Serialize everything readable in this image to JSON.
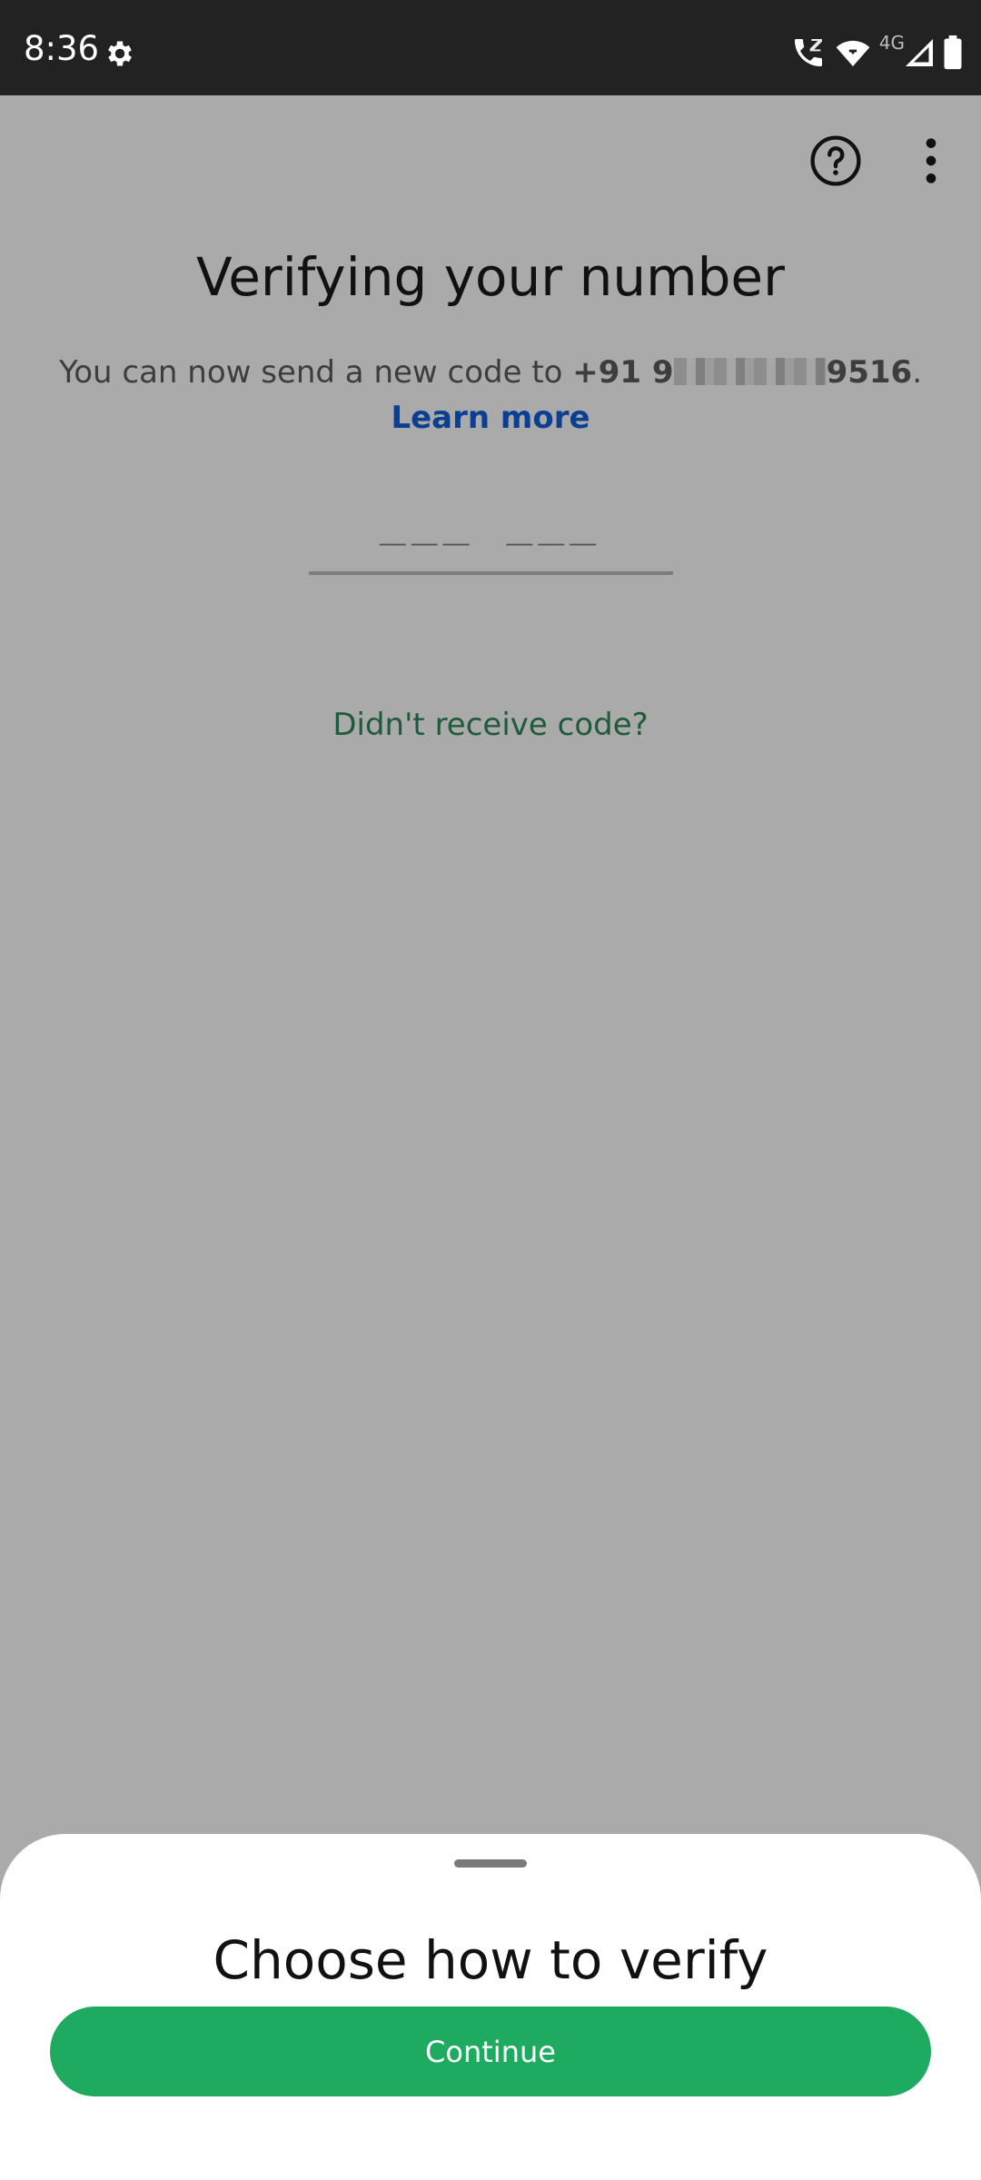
{
  "status_bar": {
    "time": "8:36",
    "network_label": "4G",
    "icons": [
      "settings-gear-icon",
      "wifi-calling-icon",
      "wifi-icon",
      "cellular-signal-icon",
      "battery-icon"
    ]
  },
  "app_bar": {
    "icons": [
      "help-icon",
      "more-options-icon"
    ]
  },
  "screen": {
    "title": "Verifying your number",
    "subtitle_prefix": "You can now send a new code to ",
    "phone_prefix": "+91 9",
    "phone_suffix": "9516",
    "period": ".",
    "learn_more": "Learn more",
    "code_placeholder": "___  ___",
    "resend_link": "Didn't receive code?"
  },
  "sheet": {
    "title": "Choose how to verify",
    "continue_label": "Continue"
  },
  "colors": {
    "scrim": "#aaaaaa",
    "status_bar": "#222222",
    "accent_green": "#1eaa5f",
    "link_blue": "#0b3f91",
    "resend_green": "#1f5b3a"
  }
}
